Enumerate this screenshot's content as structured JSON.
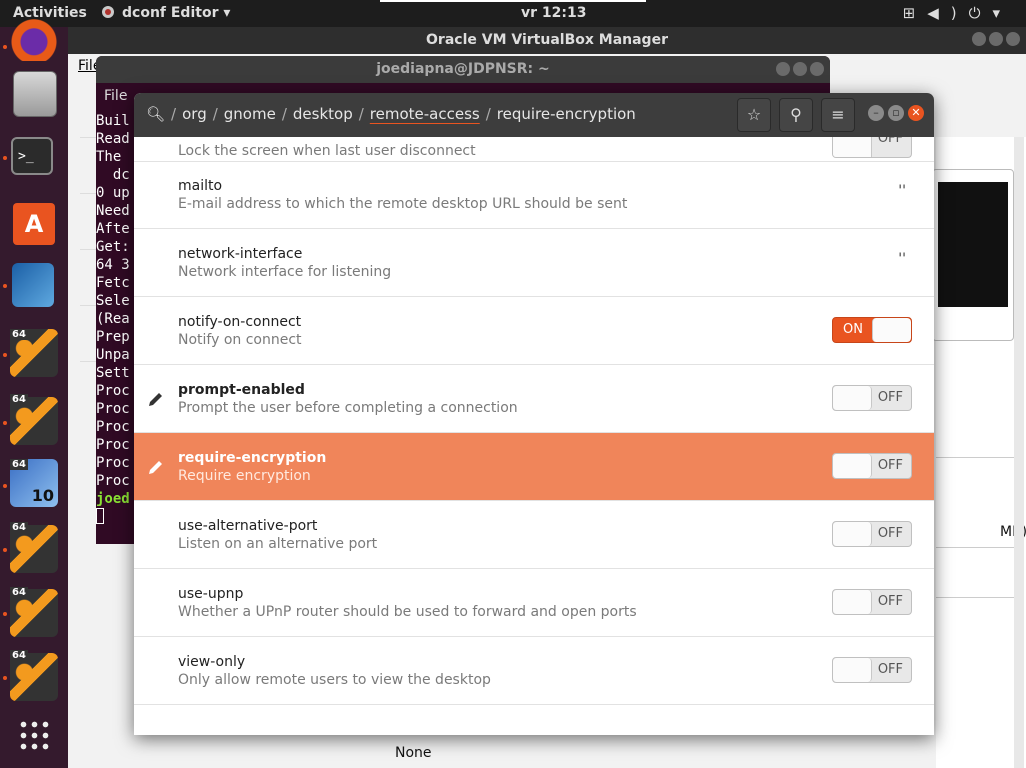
{
  "topbar": {
    "activities": "Activities",
    "app_menu": "dconf Editor ▾",
    "clock": "vr 12:13",
    "tray_icons": [
      "network-icon",
      "volume-icon",
      "power-icon"
    ]
  },
  "dock": {
    "items": [
      {
        "name": "firefox-icon"
      },
      {
        "name": "files-icon"
      },
      {
        "name": "terminal-icon"
      },
      {
        "name": "software-center-icon"
      },
      {
        "name": "virtualbox-icon"
      },
      {
        "name": "vm-icon-1",
        "badge": "64"
      },
      {
        "name": "vm-icon-2",
        "badge": "64"
      },
      {
        "name": "vm-icon-windows10",
        "badge": "64"
      },
      {
        "name": "vm-icon-3",
        "badge": "64"
      },
      {
        "name": "vm-icon-4",
        "badge": "64"
      },
      {
        "name": "vm-icon-5",
        "badge": "64"
      }
    ],
    "show_apps": "show-applications-icon"
  },
  "vbox": {
    "title": "Oracle VM VirtualBox Manager",
    "menu_file": "File",
    "mb_text": "MB)",
    "none_text": "None"
  },
  "terminal": {
    "title": "joediapna@JDPNSR: ~",
    "menu_file": "File",
    "lines": [
      "Buil",
      "Read",
      "The ",
      "  dc",
      "0 up",
      "Need",
      "Afte",
      "Get:",
      "64 3",
      "Fetc",
      "Sele",
      "(Rea",
      "Prep",
      "Unpa",
      "Sett",
      "Proc",
      "Proc",
      "Proc",
      "Proc",
      "Proc",
      "Proc"
    ],
    "prompt": "joed"
  },
  "dconf": {
    "breadcrumb": [
      "org",
      "gnome",
      "desktop",
      "remote-access",
      "require-encryption"
    ],
    "breadcrumb_active": "remote-access",
    "partial_row_desc": "Lock the screen when last user disconnect",
    "partial_row_state": "OFF",
    "rows": [
      {
        "key": "mailto",
        "desc": "E-mail address to which the remote desktop URL should be sent",
        "value": "''",
        "type": "string",
        "modified": false
      },
      {
        "key": "network-interface",
        "desc": "Network interface for listening",
        "value": "''",
        "type": "string",
        "modified": false
      },
      {
        "key": "notify-on-connect",
        "desc": "Notify on connect",
        "value": "ON",
        "type": "bool",
        "modified": false
      },
      {
        "key": "prompt-enabled",
        "desc": "Prompt the user before completing a connection",
        "value": "OFF",
        "type": "bool",
        "modified": true
      },
      {
        "key": "require-encryption",
        "desc": "Require encryption",
        "value": "OFF",
        "type": "bool",
        "modified": true,
        "selected": true
      },
      {
        "key": "use-alternative-port",
        "desc": "Listen on an alternative port",
        "value": "OFF",
        "type": "bool",
        "modified": false
      },
      {
        "key": "use-upnp",
        "desc": "Whether a UPnP router should be used to forward and open ports",
        "value": "OFF",
        "type": "bool",
        "modified": false
      },
      {
        "key": "view-only",
        "desc": "Only allow remote users to view the desktop",
        "value": "OFF",
        "type": "bool",
        "modified": false
      }
    ],
    "accent_color": "#e95420",
    "selected_row_color": "#f0855a"
  }
}
